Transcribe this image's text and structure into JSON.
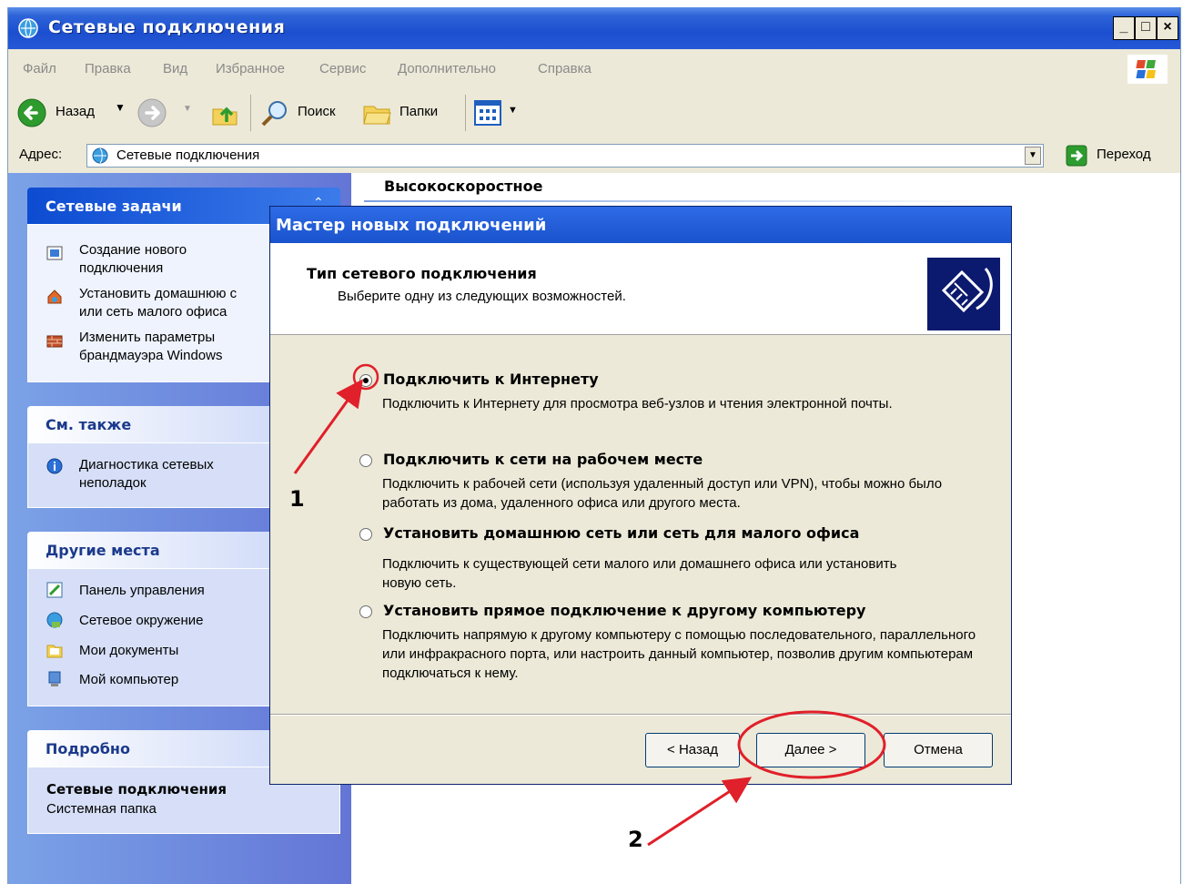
{
  "window": {
    "title": "Сетевые подключения"
  },
  "menu": [
    "Файл",
    "Правка",
    "Вид",
    "Избранное",
    "Сервис",
    "Дополнительно",
    "Справка"
  ],
  "toolbar": {
    "back_label": "Назад",
    "search_label": "Поиск",
    "folders_label": "Папки"
  },
  "address": {
    "label": "Адрес:",
    "value": "Сетевые подключения",
    "go_label": "Переход"
  },
  "content": {
    "group_heading": "Высокоскоростное"
  },
  "sidebar": {
    "tasks": {
      "title": "Сетевые задачи",
      "items": [
        {
          "line1": "Создание нового",
          "line2": "подключения"
        },
        {
          "line1": "Установить домашнюю с",
          "line2": "или сеть малого офиса"
        },
        {
          "line1": "Изменить параметры",
          "line2": "брандмауэра Windows"
        }
      ]
    },
    "see_also": {
      "title": "См. также",
      "items": [
        {
          "line1": "Диагностика сетевых",
          "line2": "неполадок"
        }
      ]
    },
    "other_places": {
      "title": "Другие места",
      "items": [
        "Панель управления",
        "Сетевое окружение",
        "Мои документы",
        "Мой компьютер"
      ]
    },
    "details": {
      "title": "Подробно",
      "name": "Сетевые подключения",
      "type": "Системная папка"
    }
  },
  "wizard": {
    "title": "Мастер новых подключений",
    "header_title": "Тип сетевого подключения",
    "header_subtitle": "Выберите одну из следующих возможностей.",
    "options": [
      {
        "title": "Подключить к Интернету",
        "desc": "Подключить к Интернету для просмотра веб-узлов и чтения  электронной почты.",
        "selected": true
      },
      {
        "title": "Подключить к сети на рабочем месте",
        "desc": "Подключить к рабочей сети (используя удаленный доступ или VPN), чтобы можно было работать из дома, удаленного офиса или другого места.",
        "selected": false
      },
      {
        "title": "Установить домашнюю сеть или сеть для малого офиса",
        "desc": "Подключить к существующей сети малого или домашнего офиса или установить новую сеть.",
        "selected": false
      },
      {
        "title": "Установить прямое подключение к другому компьютеру",
        "desc": "Подключить напрямую к другому компьютеру с помощью последовательного, параллельного или инфракрасного порта, или настроить данный компьютер, позволив другим  компьютерам подключаться к нему.",
        "selected": false
      }
    ],
    "buttons": {
      "back": "< Назад",
      "next": "Далее >",
      "cancel": "Отмена"
    }
  },
  "annotations": {
    "first": "1",
    "second": "2"
  },
  "colors": {
    "titlebar": "#1c4fcf",
    "annotation": "#e0202a",
    "panel": "#d6dff7"
  }
}
